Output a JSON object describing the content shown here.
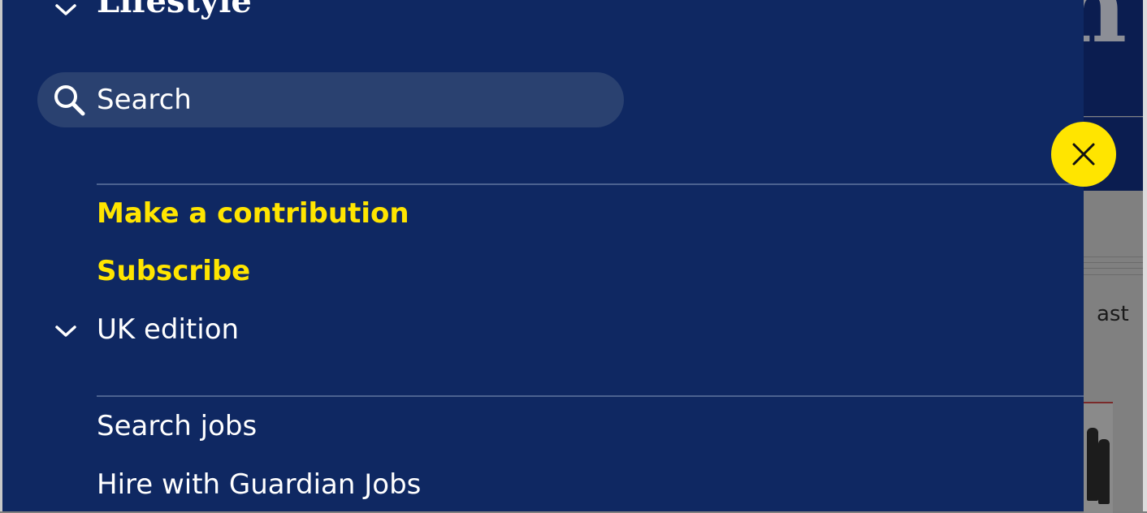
{
  "background": {
    "logo_fragment": "n",
    "text_fragment": "ast"
  },
  "drawer": {
    "section_title": "Lifestyle",
    "search": {
      "label": "Search",
      "icon": "search-icon"
    },
    "support_links": [
      {
        "label": "Make a contribution"
      },
      {
        "label": "Subscribe"
      }
    ],
    "edition": {
      "label": "UK edition",
      "icon": "chevron-down-icon"
    },
    "jobs_links": [
      {
        "label": "Search jobs"
      },
      {
        "label": "Hire with Guardian Jobs"
      }
    ]
  },
  "close_button": {
    "icon": "close-icon"
  },
  "colors": {
    "drawer_bg": "#0f2862",
    "search_bg": "#2a4170",
    "accent": "#ffe500",
    "text": "#ffffff",
    "divider": "#4c6290"
  }
}
